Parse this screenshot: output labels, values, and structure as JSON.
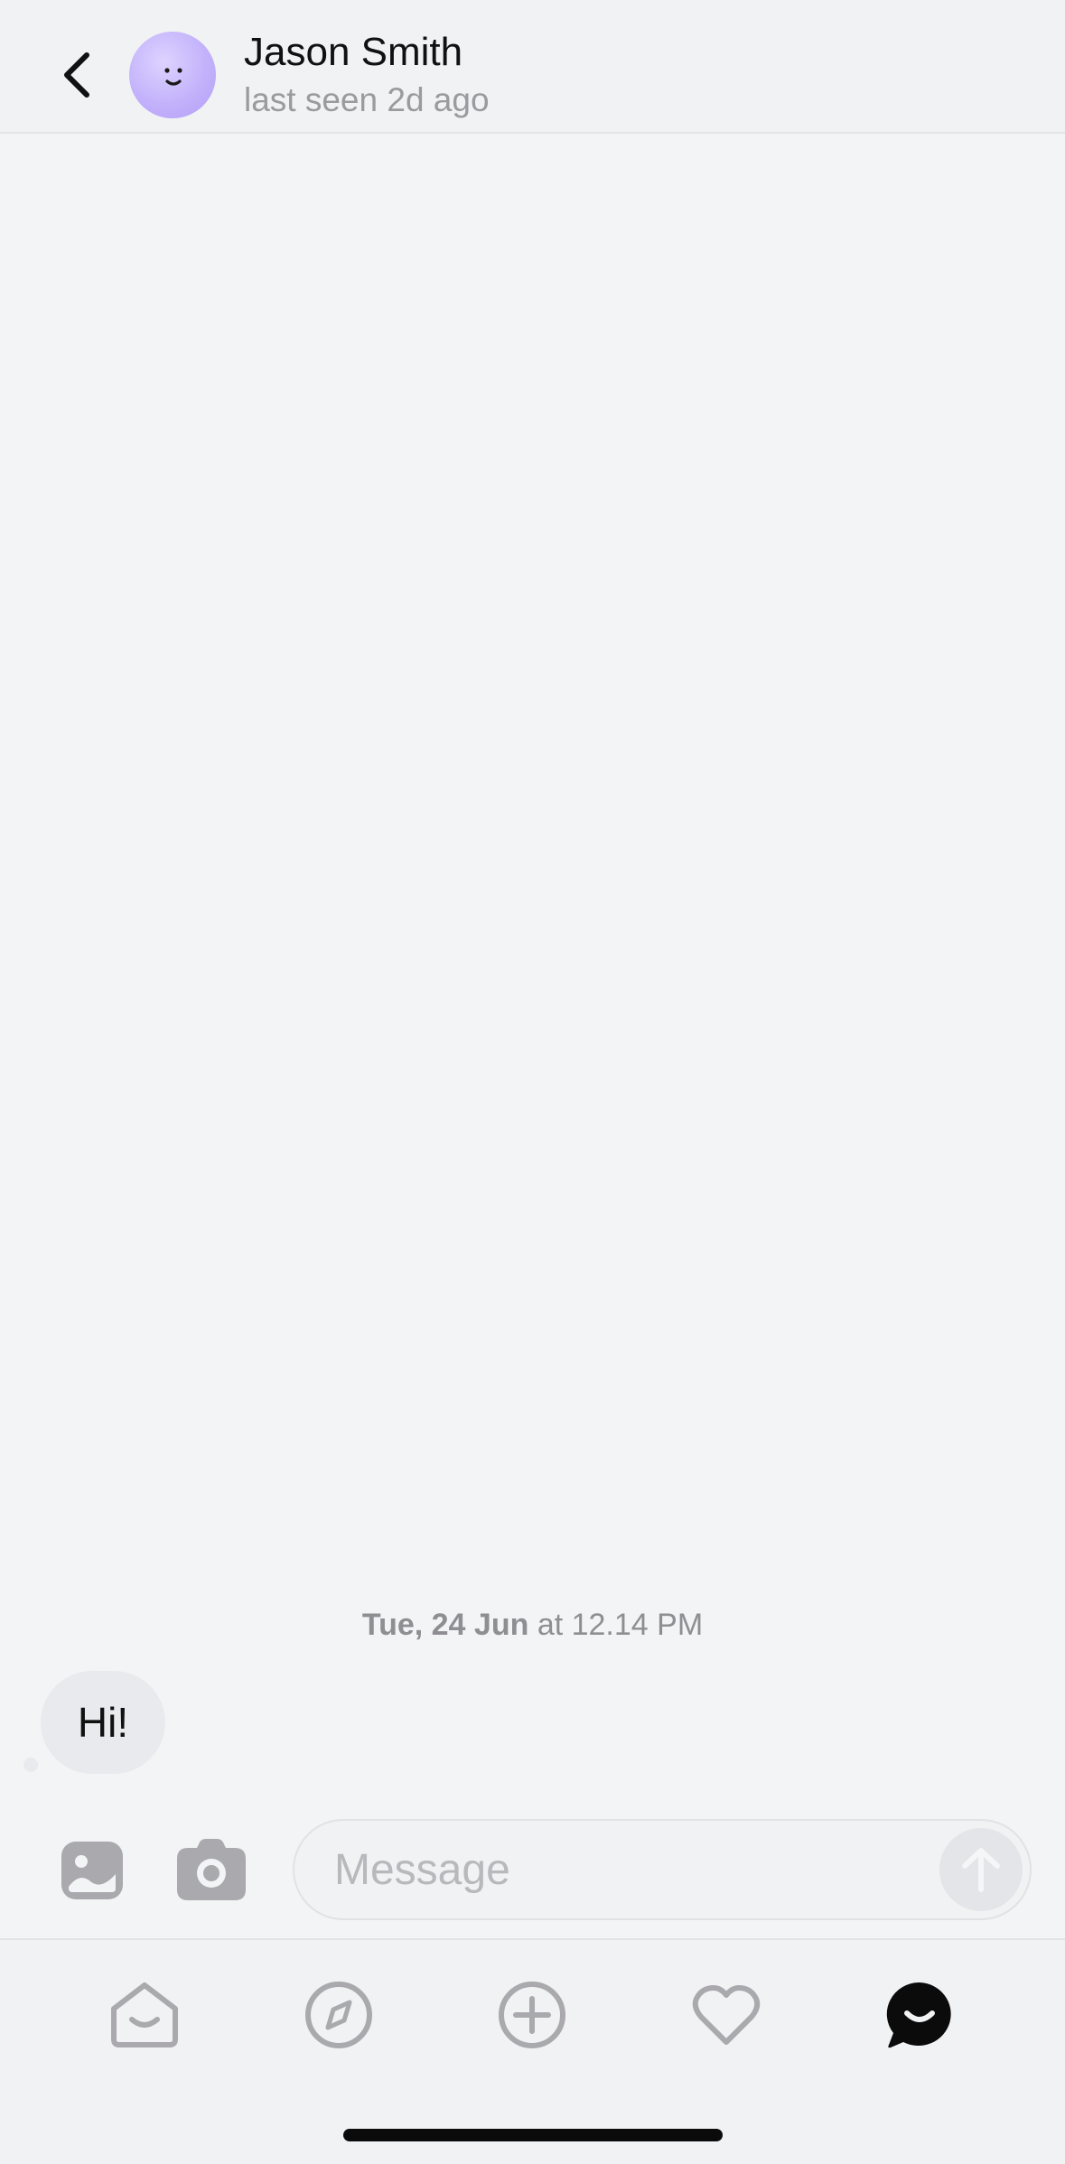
{
  "header": {
    "contact_name": "Jason Smith",
    "status": "last seen 2d ago",
    "icons": {
      "back": "chevron-left-icon",
      "avatar": "smiley-avatar"
    }
  },
  "conversation": {
    "date_separator": {
      "day": "Tue, 24 Jun",
      "time": "at 12.14 PM"
    },
    "messages": [
      {
        "direction": "incoming",
        "text": "Hi!"
      }
    ]
  },
  "composer": {
    "placeholder": "Message",
    "value": "",
    "icons": [
      "gallery-icon",
      "camera-icon",
      "send-arrow-icon"
    ]
  },
  "tabbar": {
    "items": [
      {
        "name": "home",
        "icon": "home-icon",
        "active": false
      },
      {
        "name": "explore",
        "icon": "compass-icon",
        "active": false
      },
      {
        "name": "create",
        "icon": "plus-circle-icon",
        "active": false
      },
      {
        "name": "activity",
        "icon": "heart-icon",
        "active": false
      },
      {
        "name": "messages",
        "icon": "chat-bubble-icon",
        "active": true
      }
    ]
  },
  "colors": {
    "background": "#f3f4f6",
    "bar_background": "#f1f2f4",
    "inactive_icon": "#a9a9ae",
    "active_icon": "#0b0b0b",
    "avatar": "#c3b2fb",
    "bubble": "#e9eaed"
  }
}
